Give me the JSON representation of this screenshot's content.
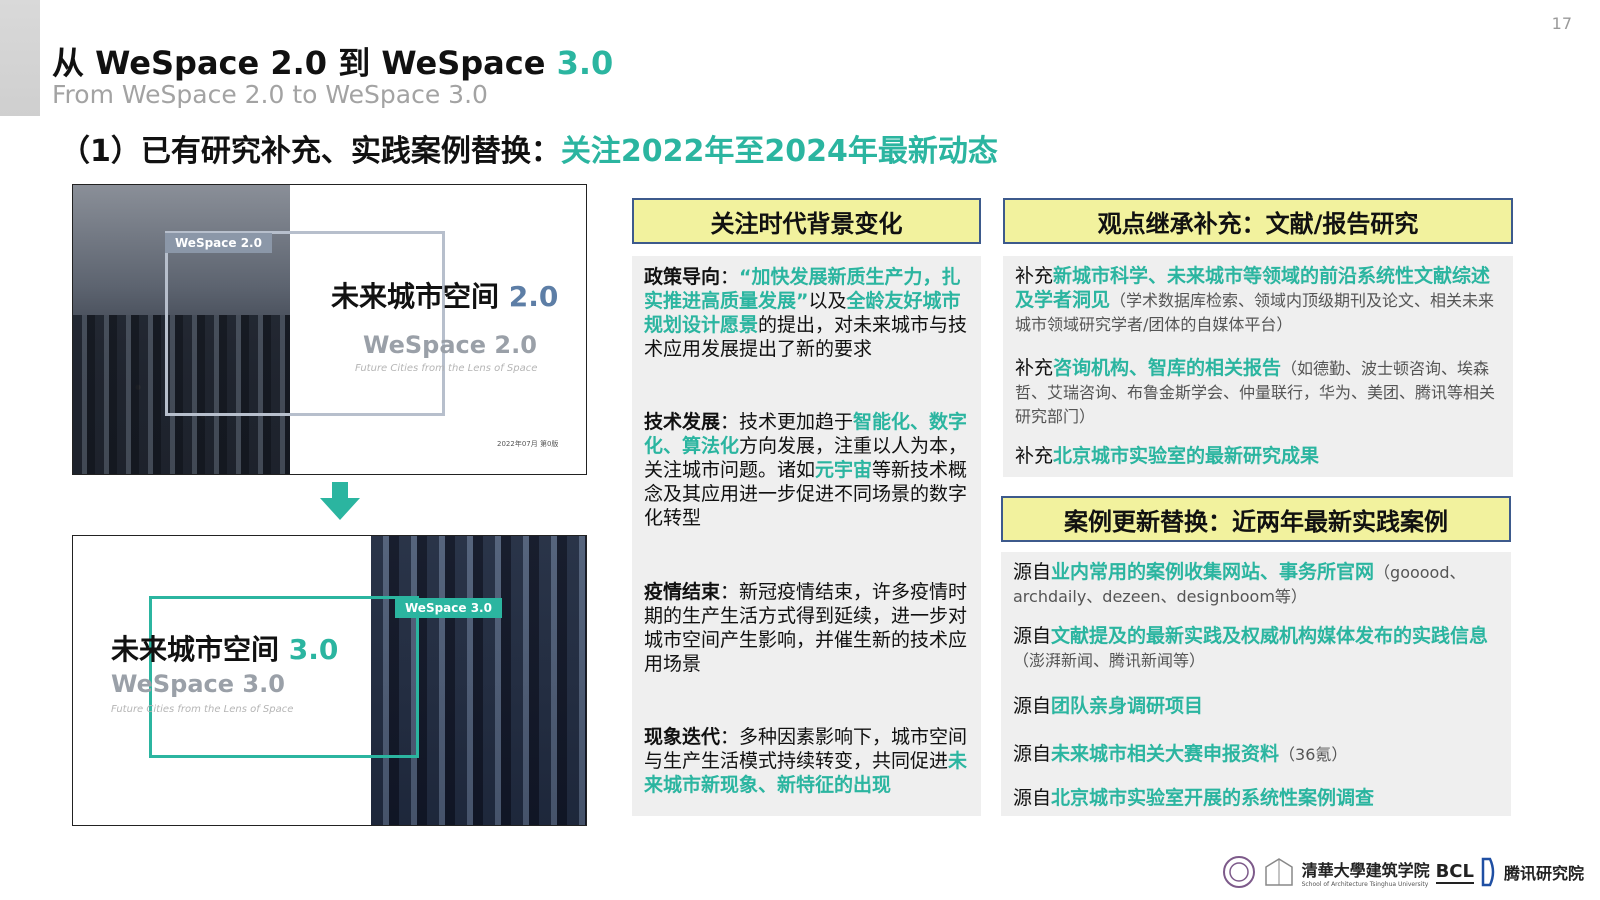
{
  "page_number": "17",
  "title": {
    "prefix": "从 WeSpace 2.0 到 WeSpace ",
    "highlight": "3.0"
  },
  "subtitle": "From WeSpace 2.0 to WeSpace 3.0",
  "section": {
    "lead": "（1）已有研究补充、实践案例替换：",
    "highlight": "关注2022年至2024年最新动态"
  },
  "thumb_2": {
    "tag": "WeSpace 2.0",
    "title": "未来城市空间 ",
    "version": "2.0",
    "brand": "WeSpace 2.0",
    "tagline": "Future Cities from the Lens of Space",
    "footer": "2022年07月 第0版"
  },
  "thumb_3": {
    "tag": "WeSpace 3.0",
    "title": "未来城市空间 ",
    "version": "3.0",
    "brand": "WeSpace 3.0",
    "tagline": "Future Cities from the Lens of Space"
  },
  "left_panel": {
    "header": "关注时代背景变化",
    "items": [
      {
        "label": "政策导向",
        "sep": "：",
        "h1": "“加快发展新质生产力，扎实推进高质量发展”",
        "t1": "以及",
        "h2": "全龄友好城市规划设计愿景",
        "t2": "的提出，对未来城市与技术应用发展提出了新的要求"
      },
      {
        "label": "技术发展",
        "sep": "：",
        "t0": "技术更加趋于",
        "h1": "智能化、数字化、算法化",
        "t1": "方向发展，注重以人为本，关注城市问题。诸如",
        "h2": "元宇宙",
        "t2": "等新技术概念及其应用进一步促进不同场景的数字化转型"
      },
      {
        "label": "疫情结束",
        "sep": "：",
        "t0": "新冠疫情结束，许多疫情时期的生产生活方式得到延续，进一步对城市空间产生影响，并催生新的技术应用场景"
      },
      {
        "label": "现象迭代",
        "sep": "：",
        "t0": "多种因素影响下，城市空间与生产生活模式持续转变，共同促进",
        "h1": "未来城市新现象、新特征的出现"
      }
    ]
  },
  "right_top": {
    "header": "观点继承补充：文献/报告研究",
    "items": [
      {
        "lead": "补充",
        "h": "新城市科学、未来城市等领域的前沿系统性文献综述及学者洞见",
        "note": "（学术数据库检索、领域内顶级期刊及论文、相关未来城市领域研究学者/团体的自媒体平台）"
      },
      {
        "lead": "补充",
        "h": "咨询机构、智库的相关报告",
        "note": "（如德勤、波士顿咨询、埃森哲、艾瑞咨询、布鲁金斯学会、仲量联行，华为、美团、腾讯等相关研究部门）"
      },
      {
        "lead": "补充",
        "h": "北京城市实验室的最新研究成果",
        "note": ""
      }
    ]
  },
  "right_bottom": {
    "header": "案例更新替换：近两年最新实践案例",
    "items": [
      {
        "lead": "源自",
        "h": "业内常用的案例收集网站、事务所官网",
        "note": "（gooood、archdaily、dezeen、designboom等）"
      },
      {
        "lead": "源自",
        "h": "文献提及的最新实践及权威机构媒体发布的实践信息",
        "note": "（澎湃新闻、腾讯新闻等）"
      },
      {
        "lead": "源自",
        "h": "团队亲身调研项目",
        "note": ""
      },
      {
        "lead": "源自",
        "h": "未来城市相关大赛申报资料",
        "note": "（36氪）"
      },
      {
        "lead": "源自",
        "h": "北京城市实验室开展的系统性案例调查",
        "note": ""
      }
    ]
  },
  "logos": {
    "tsinghua": "清華大學建筑学院",
    "tsinghua_en": "School of Architecture Tsinghua University",
    "bcl": "BCL",
    "tencent": "腾讯研究院"
  },
  "colors": {
    "accent": "#2bb5a0",
    "header_fill": "#f2f29e",
    "header_border": "#3d5a8c",
    "panel": "#efefef"
  }
}
